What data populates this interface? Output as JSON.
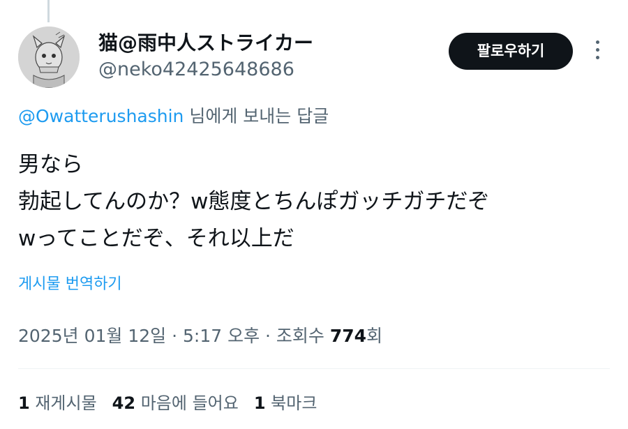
{
  "author": {
    "display_name": "猫@雨中人ストライカー",
    "handle": "@neko42425648686"
  },
  "follow_button_label": "팔로우하기",
  "more_icon": "more-vertical-icon",
  "reply_context": {
    "mention": "@Owatterushashin",
    "suffix": "님에게 보내는 답글"
  },
  "tweet": {
    "lines": [
      "男なら",
      "勃起してんのか？w態度とちんぽガッチガチだぞ",
      "wってことだぞ、それ以上だ"
    ]
  },
  "translate_label": "게시물 번역하기",
  "meta": {
    "date": "2025년 01월 12일",
    "separator": " · ",
    "time": "5:17 오후",
    "views_label": "조회수",
    "views_count": "774",
    "views_unit": "회"
  },
  "stats": [
    {
      "count": "1",
      "label": "재게시물"
    },
    {
      "count": "42",
      "label": "마음에 들어요"
    },
    {
      "count": "1",
      "label": "북마크"
    }
  ],
  "colors": {
    "accent": "#1d9bf0",
    "text": "#0f1419",
    "secondary": "#536471",
    "button_bg": "#0f1419"
  }
}
